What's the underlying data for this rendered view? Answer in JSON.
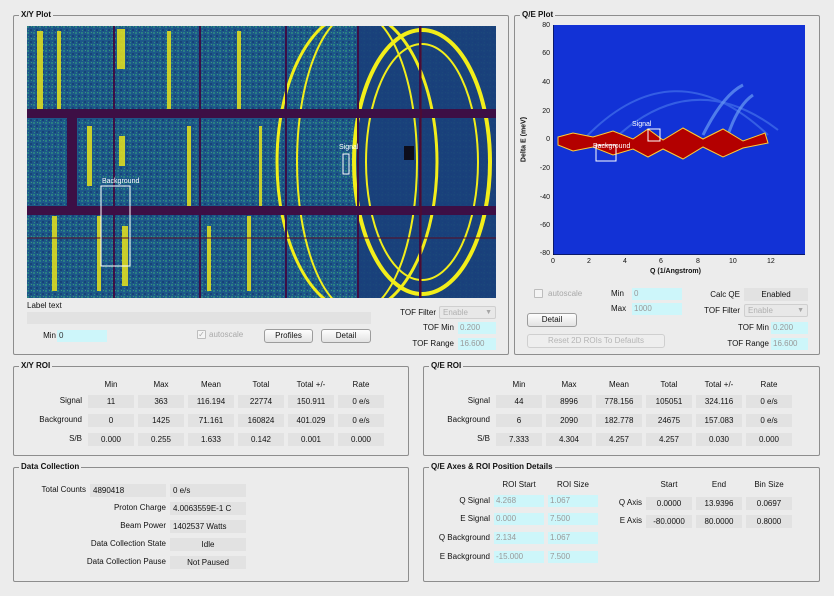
{
  "xy_plot": {
    "title": "X/Y Plot",
    "signal_label": "Signal",
    "background_label": "Background",
    "label_text_caption": "Label text",
    "min_label": "Min",
    "min_value": "0",
    "autoscale_label": "autoscale",
    "profiles_button": "Profiles",
    "detail_button": "Detail",
    "tof_filter_label": "TOF Filter",
    "tof_filter_value": "Enable",
    "tof_min_label": "TOF Min",
    "tof_min_value": "0.200",
    "tof_range_label": "TOF Range",
    "tof_range_value": "16.600"
  },
  "qe_plot": {
    "title": "Q/E Plot",
    "signal_label": "Signal",
    "background_label": "Background",
    "y_axis_label": "Delta E (meV)",
    "x_axis_label": "Q (1/Angstrom)",
    "y_ticks": [
      "80",
      "60",
      "40",
      "20",
      "0",
      "-20",
      "-40",
      "-60",
      "-80"
    ],
    "x_ticks": [
      "0",
      "2",
      "4",
      "6",
      "8",
      "10",
      "12"
    ],
    "autoscale_label": "autoscale",
    "min_label": "Min",
    "min_value": "0",
    "max_label": "Max",
    "max_value": "1000",
    "detail_button": "Detail",
    "calc_qe_label": "Calc QE",
    "calc_qe_value": "Enabled",
    "tof_filter_label": "TOF Filter",
    "tof_filter_value": "Enable",
    "tof_min_label": "TOF Min",
    "tof_min_value": "0.200",
    "tof_range_label": "TOF Range",
    "tof_range_value": "16.600",
    "reset_button": "Reset 2D ROIs To Defaults"
  },
  "xy_roi": {
    "title": "X/Y ROI",
    "columns": [
      "Min",
      "Max",
      "Mean",
      "Total",
      "Total +/-",
      "Rate"
    ],
    "rows": [
      {
        "label": "Signal",
        "values": [
          "11",
          "363",
          "116.194",
          "22774",
          "150.911",
          "0 e/s"
        ]
      },
      {
        "label": "Background",
        "values": [
          "0",
          "1425",
          "71.161",
          "160824",
          "401.029",
          "0 e/s"
        ]
      },
      {
        "label": "S/B",
        "values": [
          "0.000",
          "0.255",
          "1.633",
          "0.142",
          "0.001",
          "0.000"
        ]
      }
    ]
  },
  "qe_roi": {
    "title": "Q/E ROI",
    "columns": [
      "Min",
      "Max",
      "Mean",
      "Total",
      "Total +/-",
      "Rate"
    ],
    "rows": [
      {
        "label": "Signal",
        "values": [
          "44",
          "8996",
          "778.156",
          "105051",
          "324.116",
          "0 e/s"
        ]
      },
      {
        "label": "Background",
        "values": [
          "6",
          "2090",
          "182.778",
          "24675",
          "157.083",
          "0 e/s"
        ]
      },
      {
        "label": "S/B",
        "values": [
          "7.333",
          "4.304",
          "4.257",
          "4.257",
          "0.030",
          "0.000"
        ]
      }
    ]
  },
  "data_collection": {
    "title": "Data Collection",
    "total_counts_label": "Total Counts",
    "total_counts_value": "4890418",
    "total_counts_rate": "0 e/s",
    "proton_charge_label": "Proton Charge",
    "proton_charge_value": "4.0063559E-1 C",
    "beam_power_label": "Beam Power",
    "beam_power_value": "1402537 Watts",
    "state_label": "Data Collection State",
    "state_value": "Idle",
    "pause_label": "Data Collection Pause",
    "pause_value": "Not Paused"
  },
  "qe_axes": {
    "title": "Q/E Axes & ROI Position Details",
    "roi_start_header": "ROI Start",
    "roi_size_header": "ROI Size",
    "rows": [
      {
        "label": "Q Signal",
        "start": "4.268",
        "size": "1.067"
      },
      {
        "label": "E Signal",
        "start": "0.000",
        "size": "7.500"
      },
      {
        "label": "Q Background",
        "start": "2.134",
        "size": "1.067"
      },
      {
        "label": "E Background",
        "start": "-15.000",
        "size": "7.500"
      }
    ],
    "axis_headers": [
      "Start",
      "End",
      "Bin Size"
    ],
    "axes": [
      {
        "label": "Q Axis",
        "start": "0.0000",
        "end": "13.9396",
        "bin": "0.0697"
      },
      {
        "label": "E Axis",
        "start": "-80.0000",
        "end": "80.0000",
        "bin": "0.8000"
      }
    ]
  },
  "colors": {
    "detector_base": "#1e4f8a",
    "detector_hot": "#f2ee1a",
    "detector_gap": "#3d0f45",
    "qe_background": "#1232d6",
    "qe_hot": "#b30000"
  }
}
